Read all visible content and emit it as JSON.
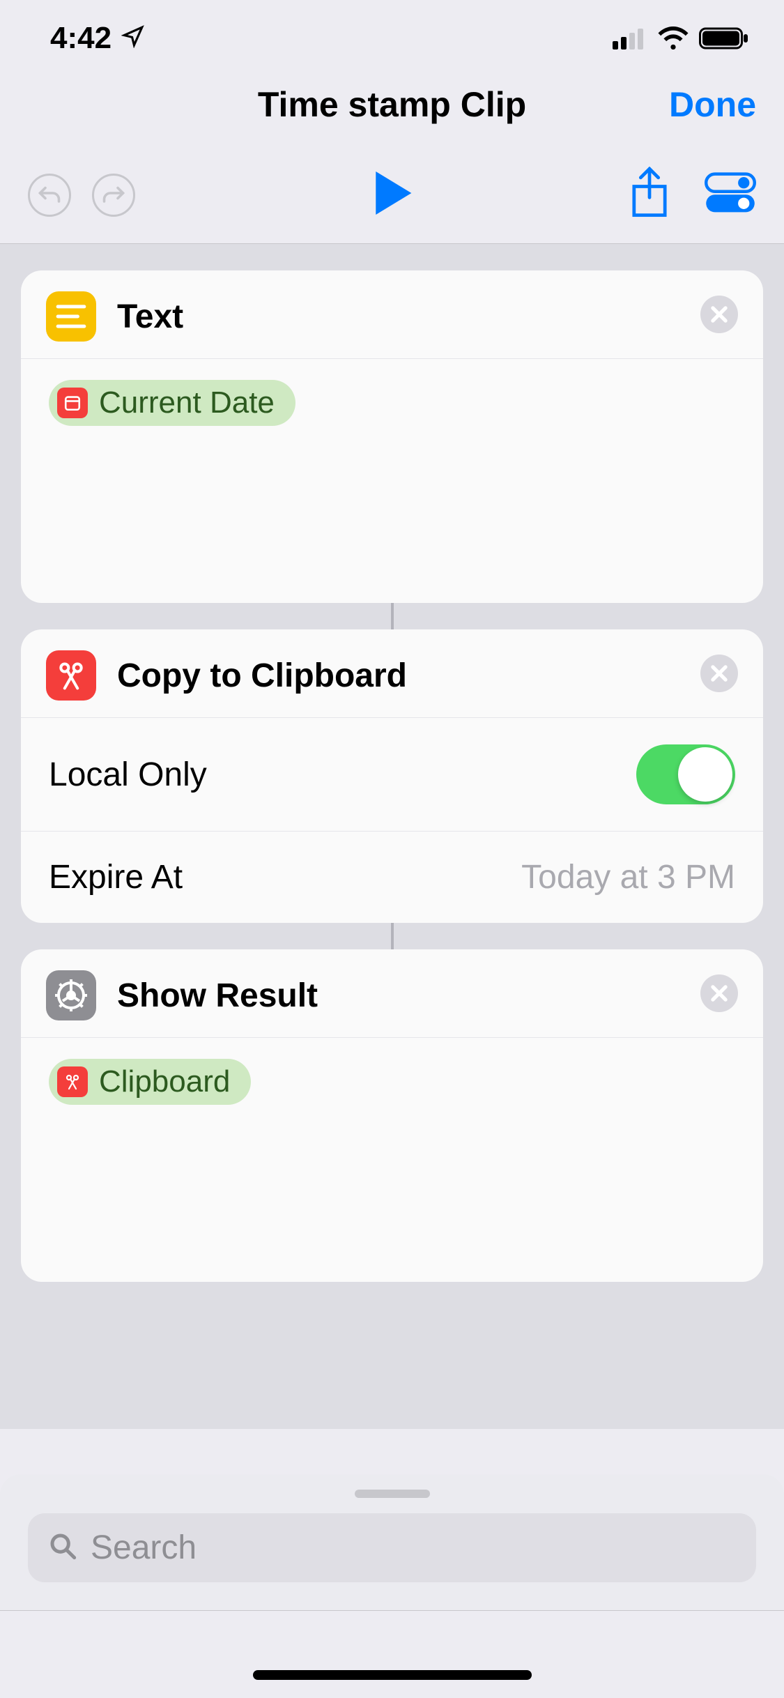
{
  "status_bar": {
    "time": "4:42"
  },
  "header": {
    "title": "Time stamp Clip",
    "done_label": "Done"
  },
  "actions": [
    {
      "title": "Text",
      "icon": "text-icon",
      "icon_color": "yellow",
      "body_token": {
        "label": "Current Date",
        "icon": "calendar-icon",
        "variant": "green"
      }
    },
    {
      "title": "Copy to Clipboard",
      "icon": "scissors-icon",
      "icon_color": "red",
      "rows": [
        {
          "label": "Local Only",
          "control": "switch",
          "value": true
        },
        {
          "label": "Expire At",
          "control": "value",
          "value": "Today at 3 PM"
        }
      ]
    },
    {
      "title": "Show Result",
      "icon": "gear-icon",
      "icon_color": "gray",
      "body_token": {
        "label": "Clipboard",
        "icon": "scissors-icon",
        "variant": "green"
      }
    }
  ],
  "search": {
    "placeholder": "Search"
  }
}
